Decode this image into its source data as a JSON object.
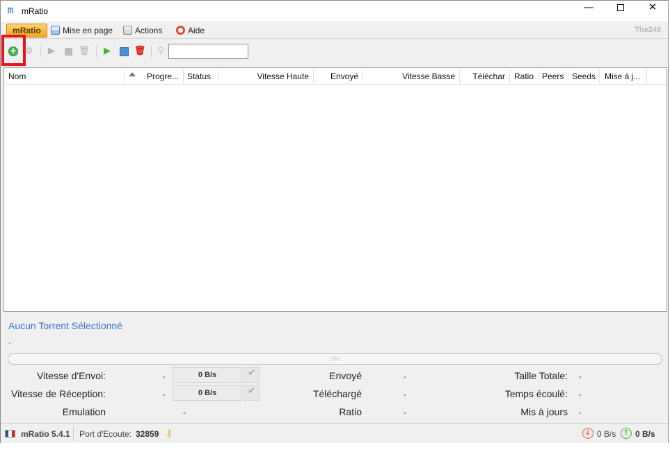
{
  "window": {
    "title": "mRatio",
    "minimize": "—",
    "close": "✕"
  },
  "menu": {
    "main_label": "mRatio",
    "items": [
      {
        "label": "Mise en page",
        "icon": "layout-icon"
      },
      {
        "label": "Actions",
        "icon": "actions-icon"
      },
      {
        "label": "Aide",
        "icon": "help-lifebuoy-icon"
      }
    ],
    "brand": "The248"
  },
  "toolbar": {
    "search_value": "",
    "icons": [
      "add-torrent-icon",
      "settings-icon",
      "start-icon",
      "stop-icon",
      "remove-icon",
      "start-all-icon",
      "save-icon",
      "delete-all-icon",
      "search-icon"
    ]
  },
  "table": {
    "columns": [
      "Nom",
      "Progre...",
      "Status",
      "Vitesse Haute",
      "Envoyé",
      "Vitesse Basse",
      "Téléchar",
      "Ratio",
      "Peers",
      "Seeds",
      "Mise à j..."
    ],
    "rows": []
  },
  "details": {
    "title": "Aucun Torrent Sélectionné",
    "subtitle": "-",
    "progress_label": "0%",
    "progress_fraction": 0,
    "send_speed_label": "Vitesse d'Envoi:",
    "send_speed_value": "-",
    "send_speed_box": "0 B/s",
    "recv_speed_label": "Vitesse de Réception:",
    "recv_speed_value": "-",
    "recv_speed_box": "0 B/s",
    "emulation_label": "Emulation",
    "emulation_value": "-",
    "sent_label": "Envoyé",
    "sent_value": "-",
    "downloaded_label": "Téléchargé",
    "downloaded_value": "-",
    "ratio_label": "Ratio",
    "ratio_value": "-",
    "total_size_label": "Taille Totale:",
    "total_size_value": "-",
    "elapsed_label": "Temps écoulé:",
    "elapsed_value": "-",
    "updated_label": "Mis à jours",
    "updated_value": "-"
  },
  "status": {
    "version": "mRatio 5.4.1",
    "port_label": "Port d'Ecoute:",
    "port": "32859",
    "download_rate": "0 B/s",
    "upload_rate": "0 B/s"
  },
  "colors": {
    "accent": "#f0a81e",
    "link": "#3a6fd0",
    "highlight": "#e8141c"
  }
}
